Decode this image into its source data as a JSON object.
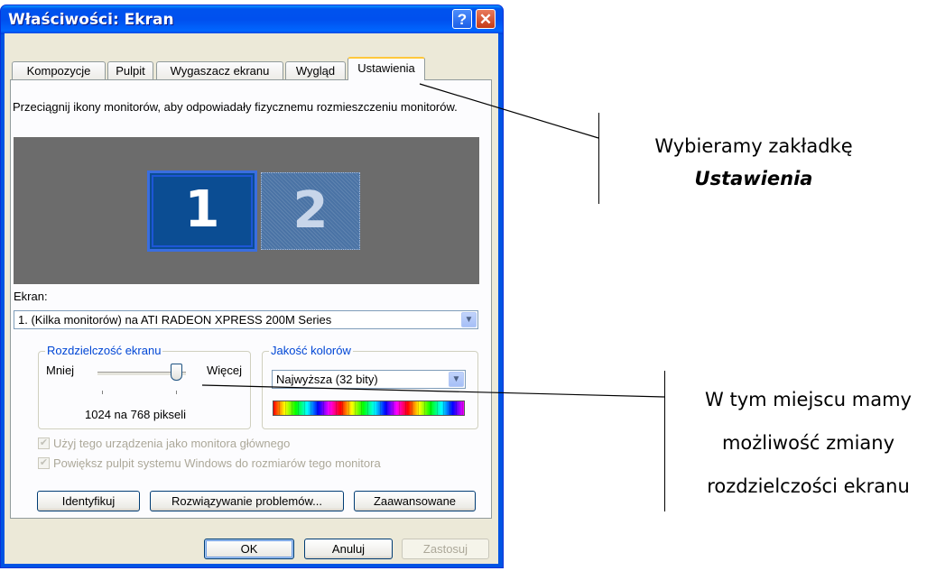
{
  "window": {
    "title": "Właściwości: Ekran",
    "help_glyph": "?",
    "close_glyph": "✕"
  },
  "tabs": [
    {
      "label": "Kompozycje"
    },
    {
      "label": "Pulpit"
    },
    {
      "label": "Wygaszacz ekranu"
    },
    {
      "label": "Wygląd"
    },
    {
      "label": "Ustawienia",
      "active": true
    }
  ],
  "settings": {
    "instruction": "Przeciągnij ikony monitorów, aby odpowiadały fizycznemu rozmieszczeniu monitorów.",
    "monitors": [
      "1",
      "2"
    ],
    "display_label": "Ekran:",
    "display_value": "1. (Kilka monitorów) na ATI RADEON XPRESS 200M Series",
    "resolution_group": "Rozdzielczość ekranu",
    "less_label": "Mniej",
    "more_label": "Więcej",
    "resolution_value": "1024 na 768 pikseli",
    "resolution_level": 0.85,
    "color_group": "Jakość kolorów",
    "color_value": "Najwyższa (32 bity)",
    "primary_checkbox": "Użyj tego urządzenia jako monitora głównego",
    "extend_checkbox": "Powiększ pulpit systemu Windows do rozmiarów tego monitora"
  },
  "buttons": {
    "identify": "Identyfikuj",
    "troubleshoot": "Rozwiązywanie problemów...",
    "advanced": "Zaawansowane",
    "ok": "OK",
    "cancel": "Anuluj",
    "apply": "Zastosuj"
  },
  "annotations": {
    "tab_note_line1": "Wybieramy zakładkę",
    "tab_note_line2": "Ustawienia",
    "res_note_line1": "W tym miejscu mamy",
    "res_note_line2": "możliwość zmiany",
    "res_note_line3": "rozdzielczości ekranu"
  },
  "colors": {
    "title_blue": "#0054e3",
    "group_title": "#0046d5",
    "monitor_bg": "#6c6c6c",
    "selected_monitor": "#0b4d93"
  }
}
